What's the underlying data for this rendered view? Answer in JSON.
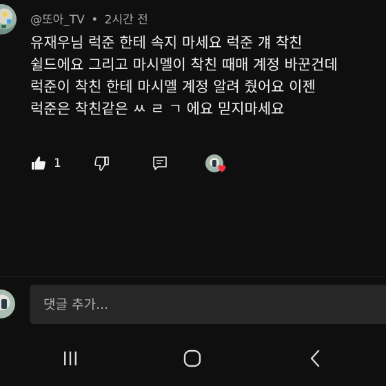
{
  "comment": {
    "author": "@또아_TV",
    "separator": "•",
    "time": "2시간 전",
    "lines": [
      "유재우님 럭준 한테 속지 마세요 럭준 걔 착친",
      "쉴드에요 그리고 마시멜이 착친 때매 계정 바꾼건데",
      "럭준이 착친 한테 마시멜 계정 알려 줬어요 이젠",
      "럭준은 착친같은 ㅆ ㄹ ㄱ 에요 믿지마세요"
    ],
    "like_count": "1",
    "icons": {
      "like": "thumbs-up-icon",
      "dislike": "thumbs-down-icon",
      "reply": "reply-icon",
      "creator_heart": "heart-icon"
    },
    "heart_color": "#ff2c3c"
  },
  "reply_box": {
    "placeholder": "댓글 추가..."
  },
  "nav": {
    "icons": [
      "recents-icon",
      "home-icon",
      "back-icon"
    ]
  }
}
